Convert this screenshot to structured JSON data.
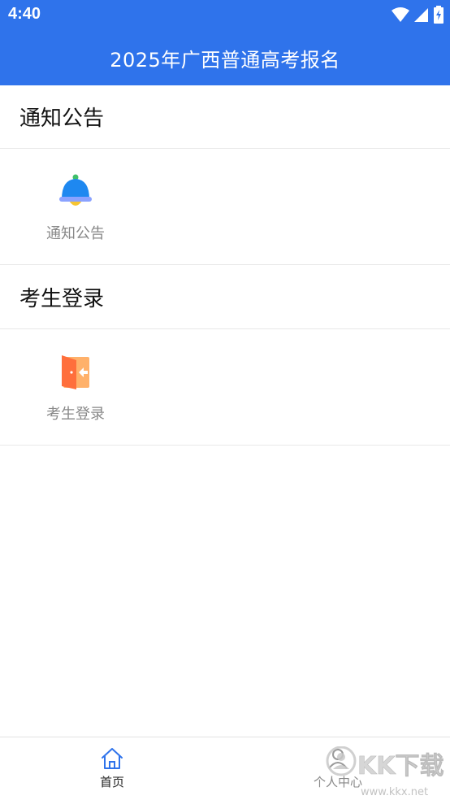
{
  "status_bar": {
    "time": "4:40"
  },
  "app_bar": {
    "title": "2025年广西普通高考报名"
  },
  "sections": [
    {
      "title": "通知公告",
      "items": [
        {
          "label": "通知公告",
          "icon": "bell-icon"
        }
      ]
    },
    {
      "title": "考生登录",
      "items": [
        {
          "label": "考生登录",
          "icon": "door-login-icon"
        }
      ]
    }
  ],
  "bottom_nav": {
    "items": [
      {
        "label": "首页",
        "icon": "home-icon",
        "active": true
      },
      {
        "label": "个人中心",
        "icon": "user-icon",
        "active": false
      }
    ]
  },
  "watermark": {
    "text": "KK下载",
    "url": "www.kkx.net"
  },
  "colors": {
    "primary": "#2f73eb",
    "bell_blue": "#1e88f0",
    "bell_yellow": "#f7c531",
    "door_orange": "#ff7a45",
    "text_muted": "#888888"
  }
}
